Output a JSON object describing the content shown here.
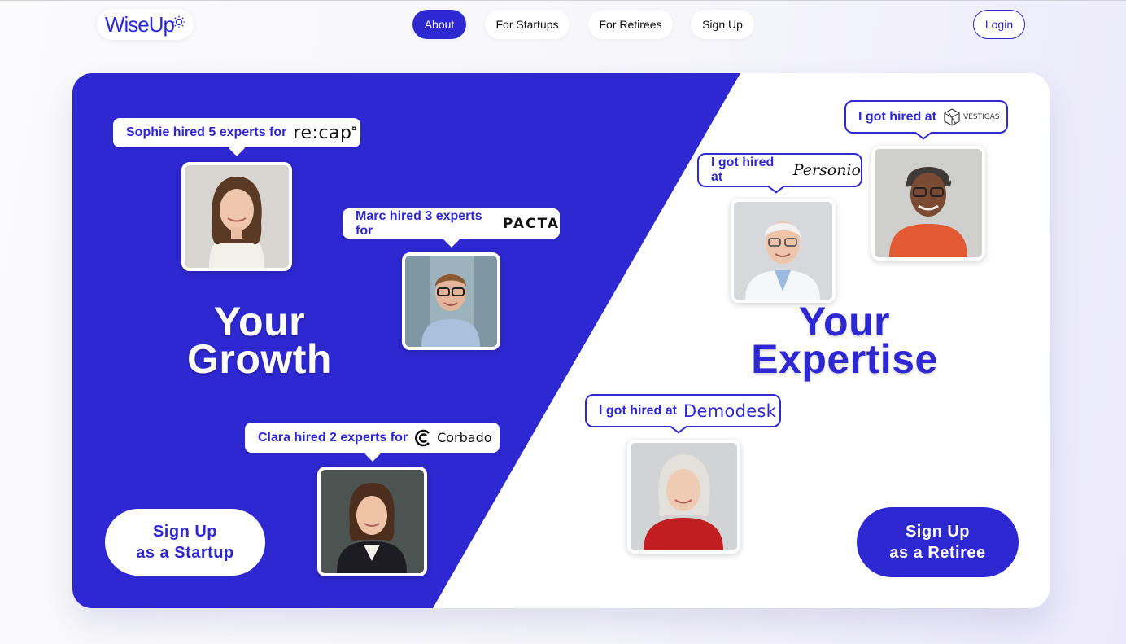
{
  "nav": {
    "logo": "WiseUp",
    "items": [
      {
        "label": "About",
        "active": true
      },
      {
        "label": "For Startups",
        "active": false
      },
      {
        "label": "For Retirees",
        "active": false
      },
      {
        "label": "Sign Up",
        "active": false
      }
    ],
    "login": "Login"
  },
  "colors": {
    "brand": "#2e28d2",
    "white": "#ffffff"
  },
  "startups": {
    "headline_1": "Your",
    "headline_2": "Growth",
    "testimonials": [
      {
        "text": "Sophie hired 5 experts for",
        "company": "re:cap",
        "avatar": "woman-brown-hair-photo"
      },
      {
        "text": "Marc hired 3 experts for",
        "company": "PACTA",
        "avatar": "man-glasses-photo"
      },
      {
        "text": "Clara hired 2 experts for",
        "company": "Corbado",
        "avatar": "woman-blazer-photo"
      }
    ],
    "cta_line1": "Sign Up",
    "cta_line2": "as a Startup"
  },
  "retirees": {
    "headline_1": "Your",
    "headline_2": "Expertise",
    "testimonials": [
      {
        "text": "I got hired at",
        "company": "VESTIGAS",
        "avatar": "older-woman-orange-sweater-photo"
      },
      {
        "text": "I got hired at",
        "company": "Personio",
        "avatar": "older-man-labcoat-photo"
      },
      {
        "text": "I got hired at",
        "company": "Demodesk",
        "avatar": "older-woman-red-sweater-photo"
      }
    ],
    "cta_line1": "Sign Up",
    "cta_line2": "as a Retiree"
  }
}
